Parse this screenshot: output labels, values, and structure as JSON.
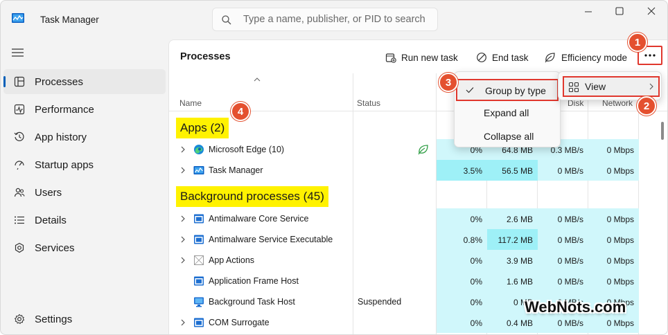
{
  "window": {
    "title": "Task Manager",
    "search_placeholder": "Type a name, publisher, or PID to search"
  },
  "sidebar": {
    "items": [
      {
        "label": "Processes",
        "icon": "processes-icon",
        "active": true
      },
      {
        "label": "Performance",
        "icon": "performance-icon"
      },
      {
        "label": "App history",
        "icon": "app-history-icon"
      },
      {
        "label": "Startup apps",
        "icon": "startup-apps-icon"
      },
      {
        "label": "Users",
        "icon": "users-icon"
      },
      {
        "label": "Details",
        "icon": "details-icon"
      },
      {
        "label": "Services",
        "icon": "services-icon"
      }
    ],
    "settings_label": "Settings"
  },
  "toolbar": {
    "title": "Processes",
    "run_new_task": "Run new task",
    "end_task": "End task",
    "efficiency_mode": "Efficiency mode",
    "more": "..."
  },
  "table": {
    "columns": {
      "name": "Name",
      "status": "Status",
      "disk": "Disk",
      "network": "Network"
    },
    "groups": [
      {
        "label": "Apps (2)"
      },
      {
        "label": "Background processes (45)"
      }
    ],
    "apps": [
      {
        "name": "Microsoft Edge (10)",
        "status": "",
        "cpu": "0%",
        "memory": "64.8 MB",
        "disk": "0.3 MB/s",
        "network": "0 Mbps",
        "icon": "edge-icon",
        "efficiency": true
      },
      {
        "name": "Task Manager",
        "status": "",
        "cpu": "3.5%",
        "memory": "56.5 MB",
        "disk": "0 MB/s",
        "network": "0 Mbps",
        "icon": "task-manager-icon"
      }
    ],
    "background": [
      {
        "name": "Antimalware Core Service",
        "status": "",
        "cpu": "0%",
        "memory": "2.6 MB",
        "disk": "0 MB/s",
        "network": "0 Mbps",
        "expandable": true
      },
      {
        "name": "Antimalware Service Executable",
        "status": "",
        "cpu": "0.8%",
        "memory": "117.2 MB",
        "disk": "0 MB/s",
        "network": "0 Mbps",
        "expandable": true
      },
      {
        "name": "App Actions",
        "status": "",
        "cpu": "0%",
        "memory": "3.9 MB",
        "disk": "0 MB/s",
        "network": "0 Mbps",
        "expandable": true
      },
      {
        "name": "Application Frame Host",
        "status": "",
        "cpu": "0%",
        "memory": "1.6 MB",
        "disk": "0 MB/s",
        "network": "0 Mbps",
        "expandable": false
      },
      {
        "name": "Background Task Host",
        "status": "Suspended",
        "cpu": "0%",
        "memory": "0 MB",
        "disk": "0 MB/s",
        "network": "0 Mbps",
        "expandable": false
      },
      {
        "name": "COM Surrogate",
        "status": "",
        "cpu": "0%",
        "memory": "0.4 MB",
        "disk": "0 MB/s",
        "network": "0 Mbps",
        "expandable": true
      }
    ]
  },
  "menu_more": {
    "group_by_type": "Group by type",
    "expand_all": "Expand all",
    "collapse_all": "Collapse all"
  },
  "menu_view": {
    "view": "View"
  },
  "callouts": [
    "1",
    "2",
    "3",
    "4"
  ],
  "watermark": "WebNots.com",
  "colors": {
    "accent": "#005fb8",
    "callout": "#e4502f",
    "highlight": "#fff200",
    "heat_light": "#d0f7fb",
    "heat_dark": "#9ef0f7"
  }
}
